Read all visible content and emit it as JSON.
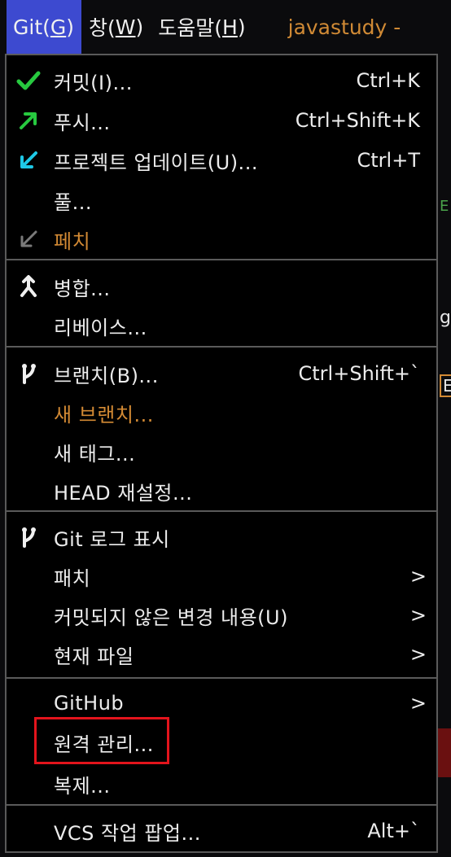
{
  "menubar": {
    "git": {
      "prefix": "Git(",
      "mnemonic": "G",
      "suffix": ")"
    },
    "window": {
      "prefix": "창(",
      "mnemonic": "W",
      "suffix": ")"
    },
    "help": {
      "prefix": "도움말(",
      "mnemonic": "H",
      "suffix": ")"
    },
    "project_name": "javastudy -"
  },
  "background_glimpses": {
    "char1": "E",
    "char2": "g",
    "char3": "E"
  },
  "menu": {
    "commit": {
      "label": "커밋(I)...",
      "shortcut": "Ctrl+K"
    },
    "push": {
      "label": "푸시...",
      "shortcut": "Ctrl+Shift+K"
    },
    "update": {
      "label": "프로젝트 업데이트(U)...",
      "shortcut": "Ctrl+T"
    },
    "pull": {
      "label": "풀..."
    },
    "fetch": {
      "label": "페치"
    },
    "merge": {
      "label": "병합..."
    },
    "rebase": {
      "label": "리베이스..."
    },
    "branches": {
      "label": "브랜치(B)...",
      "shortcut": "Ctrl+Shift+`"
    },
    "new_branch": {
      "label": "새 브랜치..."
    },
    "new_tag": {
      "label": "새 태그..."
    },
    "reset_head": {
      "label": "HEAD 재설정..."
    },
    "show_log": {
      "label": "Git 로그 표시"
    },
    "patch": {
      "label": "패치",
      "arrow": ">"
    },
    "uncommitted": {
      "label": "커밋되지 않은 변경 내용(U)",
      "arrow": ">"
    },
    "current_file": {
      "label": "현재 파일",
      "arrow": ">"
    },
    "github": {
      "label": "GitHub",
      "arrow": ">"
    },
    "manage_remotes": {
      "label": "원격 관리..."
    },
    "clone": {
      "label": "복제..."
    },
    "vcs_popup": {
      "label": "VCS 작업 팝업...",
      "shortcut": "Alt+`"
    }
  },
  "colors": {
    "menu_bg": "#000000",
    "active_menu": "#3d4ad0",
    "orange_text": "#d38a34",
    "check_green": "#27c93f",
    "arrow_cyan": "#1ec8e6",
    "highlight_red": "#e3141c"
  }
}
